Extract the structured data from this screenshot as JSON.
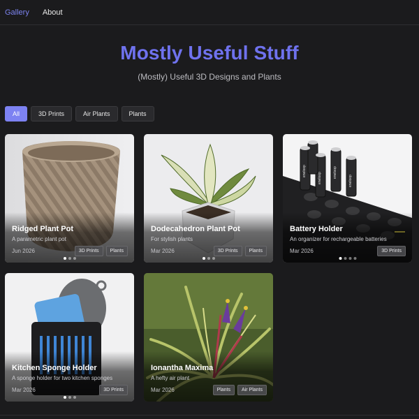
{
  "nav": {
    "items": [
      {
        "label": "Gallery",
        "active": true
      },
      {
        "label": "About",
        "active": false
      }
    ]
  },
  "hero": {
    "title": "Mostly Useful Stuff",
    "subtitle": "(Mostly) Useful 3D Designs and Plants"
  },
  "filters": [
    {
      "label": "All",
      "active": true
    },
    {
      "label": "3D Prints"
    },
    {
      "label": "Air Plants"
    },
    {
      "label": "Plants"
    }
  ],
  "colors": {
    "accent": "#7d82f2",
    "background": "#1b1b1d",
    "title": "#6f72ee"
  },
  "cards": [
    {
      "title": "Ridged Plant Pot",
      "desc": "A parametric plant pot",
      "date": "Jun 2026",
      "tags": [
        "3D Prints",
        "Plants"
      ],
      "dots": 3,
      "active_dot": 0
    },
    {
      "title": "Dodecahedron Plant Pot",
      "desc": "For stylish plants",
      "date": "Mar 2026",
      "tags": [
        "3D Prints",
        "Plants"
      ],
      "dots": 3,
      "active_dot": 0
    },
    {
      "title": "Battery Holder",
      "desc": "An organizer for rechargeable batteries",
      "date": "Mar 2026",
      "tags": [
        "3D Prints"
      ],
      "dots": 4,
      "active_dot": 0
    },
    {
      "title": "Kitchen Sponge Holder",
      "desc": "A sponge holder for two kitchen sponges",
      "date": "Mar 2026",
      "tags": [
        "3D Prints"
      ],
      "dots": 3,
      "active_dot": 0
    },
    {
      "title": "Ionantha Maxima",
      "desc": "A hefty air plant",
      "date": "Mar 2026",
      "tags": [
        "Plants",
        "Air Plants"
      ],
      "dots": 0,
      "active_dot": 0
    }
  ],
  "battery_labels": [
    "eneloop",
    "eneloop",
    "eneloop",
    "eneloop"
  ]
}
